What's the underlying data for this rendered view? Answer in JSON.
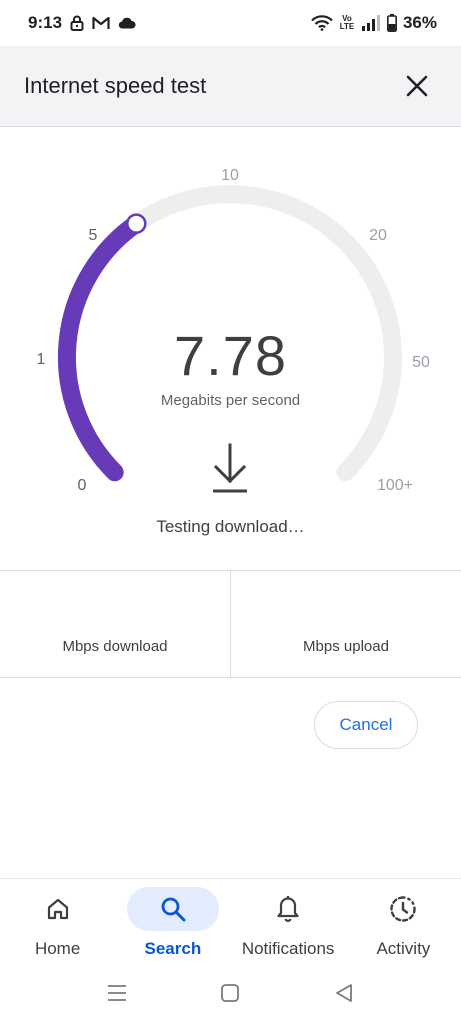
{
  "status_bar": {
    "time": "9:13",
    "network_label": "Vo LTE",
    "battery_percent": "36%",
    "icons": [
      "lock-icon",
      "gmail-icon",
      "cloud-icon",
      "wifi-icon",
      "volte-icon",
      "signal-icon",
      "battery-icon"
    ]
  },
  "header": {
    "title": "Internet speed test"
  },
  "gauge": {
    "tick_labels": [
      "0",
      "1",
      "5",
      "10",
      "20",
      "50",
      "100+"
    ],
    "current_value": "7.78",
    "unit": "Megabits per second",
    "progress_fraction": 0.37,
    "status": "Testing download…",
    "colors": {
      "progress": "#673ab7",
      "track": "#eeeeee"
    }
  },
  "results": {
    "download_label": "Mbps download",
    "upload_label": "Mbps upload"
  },
  "actions": {
    "cancel_label": "Cancel"
  },
  "bottom_nav": {
    "items": [
      {
        "label": "Home",
        "icon": "home-icon"
      },
      {
        "label": "Search",
        "icon": "search-icon",
        "active": true
      },
      {
        "label": "Notifications",
        "icon": "bell-icon"
      },
      {
        "label": "Activity",
        "icon": "activity-icon"
      }
    ]
  },
  "colors": {
    "accent": "#1a73e8",
    "active_nav": "#0b57d0",
    "active_pill": "#e3ecfd"
  }
}
